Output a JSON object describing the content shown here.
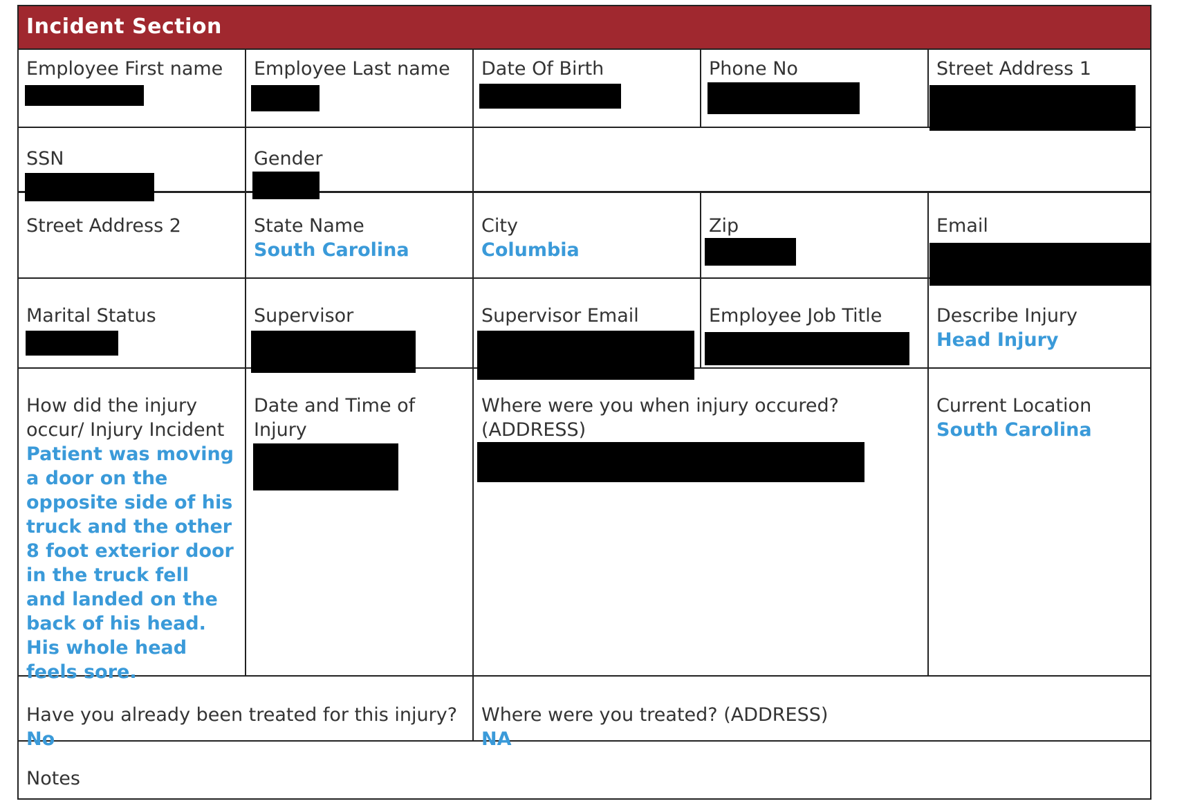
{
  "form": {
    "section_title": "Incident Section",
    "row1": {
      "first_name_label": "Employee First name",
      "last_name_label": "Employee Last name",
      "dob_label": "Date Of Birth",
      "phone_label": "Phone No",
      "address1_label": "Street Address 1"
    },
    "row2": {
      "ssn_label": "SSN",
      "gender_label": "Gender"
    },
    "row3": {
      "address2_label": "Street Address 2",
      "state_label": "State Name",
      "state_value": "South Carolina",
      "city_label": "City",
      "city_value": "Columbia",
      "zip_label": "Zip",
      "email_label": "Email"
    },
    "row4": {
      "marital_label": "Marital Status",
      "supervisor_label": "Supervisor",
      "supervisor_email_label": "Supervisor Email",
      "job_title_label": "Employee Job Title",
      "injury_label": "Describe Injury",
      "injury_value": "Head Injury"
    },
    "row5": {
      "how_label": "How did the injury occur/ Injury Incident",
      "how_value": "Patient was moving a door on the opposite side of his truck and the other 8 foot exterior door in the truck fell and landed on the back of his head. His whole head feels sore.",
      "datetime_label": "Date and Time of Injury",
      "where_label": "Where were you when injury occured? (ADDRESS)",
      "location_label": "Current Location",
      "location_value": "South Carolina"
    },
    "row6": {
      "treated_label": "Have you already been treated for this injury?",
      "treated_value": "No",
      "treated_where_label": "Where were you treated? (ADDRESS)",
      "treated_where_value": "NA"
    },
    "row7": {
      "notes_label": "Notes"
    }
  },
  "colors": {
    "header_bg": "#a0282f",
    "value_text": "#3a9ad9",
    "label_text": "#333333",
    "redaction": "#000000"
  }
}
